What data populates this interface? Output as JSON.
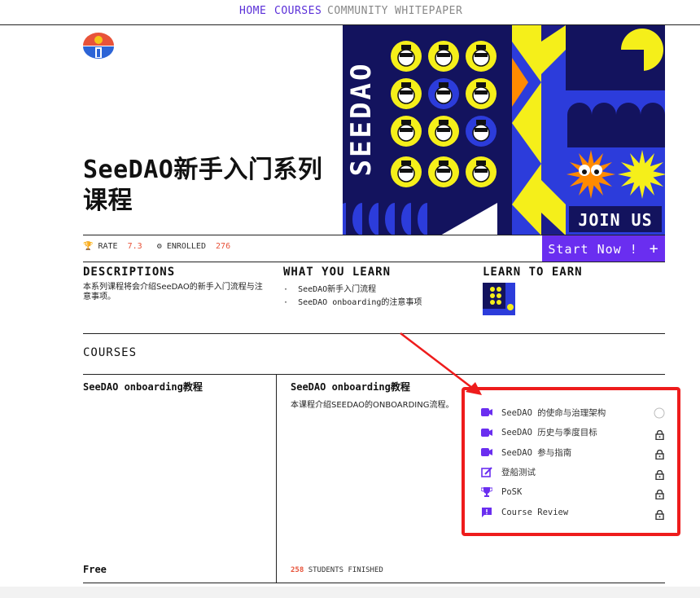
{
  "nav": {
    "home": "HOME",
    "courses": "COURSES",
    "community": "COMMUNITY",
    "whitepaper": "WHITEPAPER"
  },
  "course": {
    "title": "SeeDAO新手入门系列课程"
  },
  "hero": {
    "brand": "SEEDAO",
    "join": "JOIN US"
  },
  "stats": {
    "rate_label": "RATE",
    "rate_value": "7.3",
    "enrolled_label": "ENROLLED",
    "enrolled_value": "276"
  },
  "cta": {
    "label": "Start Now !",
    "plus": "+"
  },
  "descriptions": {
    "heading": "DESCRIPTIONS",
    "text": "本系列课程将会介绍SeeDAO的新手入门流程与注意事项。"
  },
  "learn": {
    "heading": "WHAT YOU LEARN",
    "items": [
      "SeeDAO新手入门流程",
      "SeeDAO onboarding的注意事项"
    ]
  },
  "earn": {
    "heading": "LEARN TO EARN"
  },
  "courses": {
    "heading": "COURSES",
    "left_title": "SeeDAO onboarding教程",
    "price": "Free",
    "right_title": "SeeDAO onboarding教程",
    "right_desc": "本课程介绍SEEDAO的ONBOARDING流程。",
    "finished_count": "258",
    "finished_label": "STUDENTS FINISHED",
    "lessons": [
      {
        "label": "SeeDAO 的使命与治理架构",
        "icon": "video-icon",
        "status": "circle"
      },
      {
        "label": "SeeDAO 历史与季度目标",
        "icon": "video-icon",
        "status": "lock"
      },
      {
        "label": "SeeDAO 参与指南",
        "icon": "video-icon",
        "status": "lock"
      },
      {
        "label": "登船测试",
        "icon": "edit-icon",
        "status": "lock"
      },
      {
        "label": "PoSK",
        "icon": "trophy-icon",
        "status": "lock"
      },
      {
        "label": "Course Review",
        "icon": "feedback-icon",
        "status": "lock"
      }
    ]
  },
  "colors": {
    "accent": "#6a2ef0",
    "highlight": "#e8533a",
    "annotation": "#ee1c1c",
    "hero_bg": "#13135e",
    "yellow": "#f5ef1a"
  }
}
